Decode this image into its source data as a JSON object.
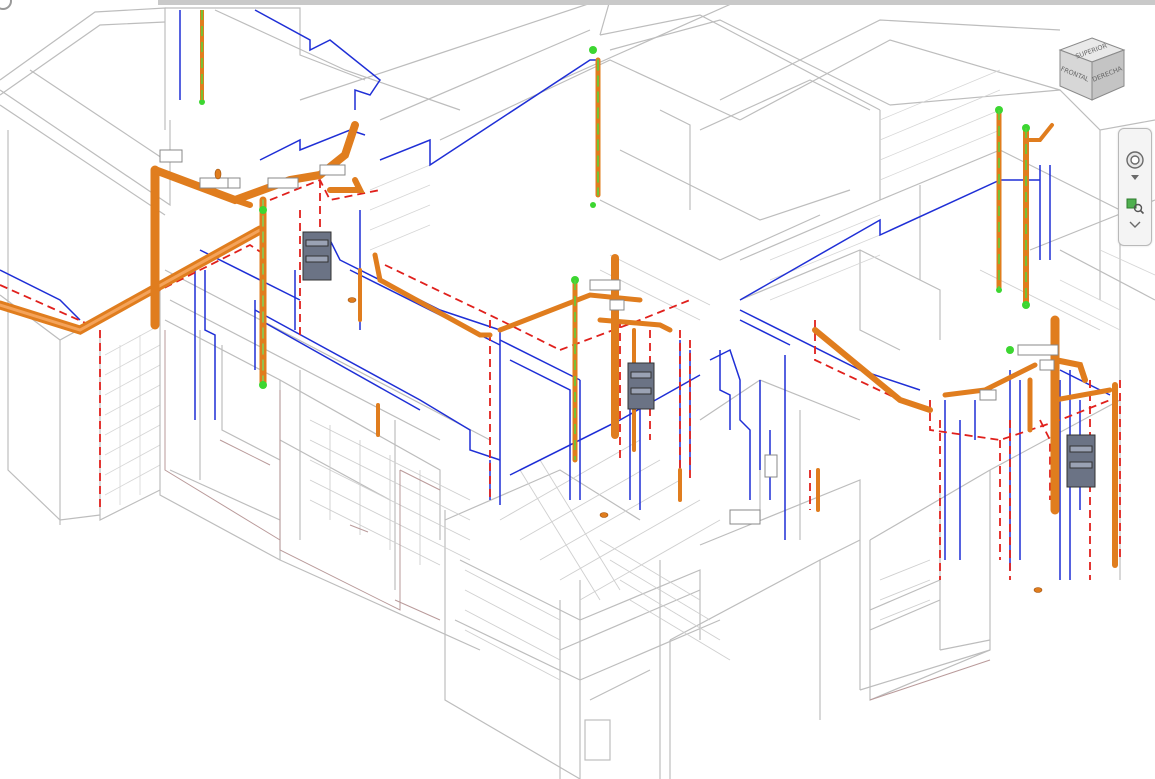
{
  "viewcube": {
    "face_front": "FRONTAL",
    "face_right": "DERECHA",
    "face_top": "SUPERIOR"
  },
  "navigation_bar": {
    "tools": [
      "full-navigation-wheel",
      "zoom-region"
    ]
  },
  "colors": {
    "wall_lines": "#bdbdbd",
    "cold_water_pipe": "#1f2fd6",
    "hot_water_pipe": "#e0201c",
    "drainage_pipe": "#e07d1e",
    "vent_pipe_caps": "#3cd631",
    "electrical_panel": "#6b7385"
  }
}
